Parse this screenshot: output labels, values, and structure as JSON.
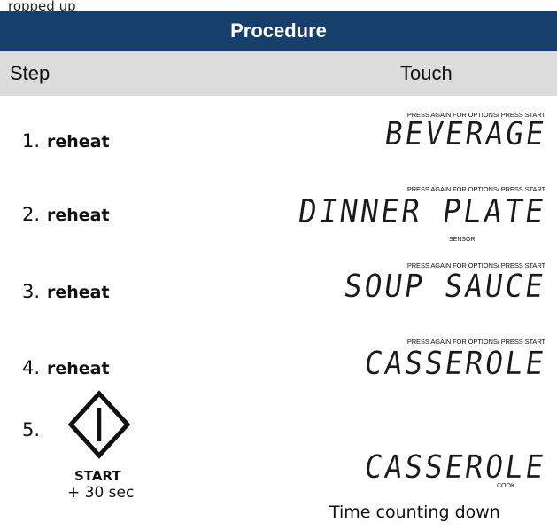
{
  "top_text": "ropped up",
  "header": {
    "title": "Procedure"
  },
  "columns": {
    "step": "Step",
    "touch": "Touch"
  },
  "steps": [
    {
      "num": "1.",
      "action": "reheat",
      "hint": "PRESS AGAIN FOR OPTIONS/  PRESS START",
      "display": "BEVERAGE",
      "sub": ""
    },
    {
      "num": "2.",
      "action": "reheat",
      "hint": "PRESS AGAIN FOR OPTIONS/  PRESS START",
      "display": "DINNER PLATE",
      "sub": "SENSOR"
    },
    {
      "num": "3.",
      "action": "reheat",
      "hint": "PRESS AGAIN FOR OPTIONS/  PRESS START",
      "display": "SOUP SAUCE",
      "sub": ""
    },
    {
      "num": "4.",
      "action": "reheat",
      "hint": "PRESS AGAIN FOR OPTIONS/  PRESS START",
      "display": "CASSEROLE",
      "sub": ""
    },
    {
      "num": "5.",
      "action_label": "START",
      "action_extra": "+ 30 sec",
      "icon": "start-diamond-icon",
      "display": "CASSEROLE",
      "sub": "COOK",
      "note": "Time counting down"
    }
  ],
  "colors": {
    "header_bg": "#173f6b",
    "column_bg": "#dcdcdc"
  }
}
